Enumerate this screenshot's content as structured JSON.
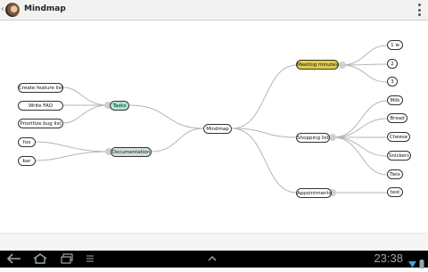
{
  "app": {
    "title": "Mindmap"
  },
  "mindmap": {
    "root": "Mindmap",
    "nodes": {
      "tasks": "Tasks",
      "documentation": "Documentation",
      "meeting_minutes": "Meeting minutes",
      "shopping_list": "Shopping list",
      "appointments": "Appointments",
      "create_feature_list": "Create feature list",
      "write_faq": "Write FAQ",
      "prioritize_bug_list": "Prioritize bug list",
      "foo": "foo",
      "bar": "bar",
      "one_w": "1 w",
      "two": "2",
      "three": "3",
      "milk": "Milk",
      "bread": "Bread",
      "cheese": "Cheese",
      "snickers": "Snickers",
      "twix": "Twix",
      "test": "test"
    }
  },
  "status": {
    "time": "23:38"
  },
  "colors": {
    "tasks_fill": "#a9e8d6",
    "documentation_fill": "#d3e0d9",
    "meeting_fill": "#e3cc4b",
    "navbar": "#000000"
  },
  "icons": {
    "nav": [
      "back-icon",
      "home-icon",
      "recent-apps-icon",
      "menu-icon"
    ],
    "status": [
      "wifi-icon",
      "battery-icon"
    ]
  }
}
